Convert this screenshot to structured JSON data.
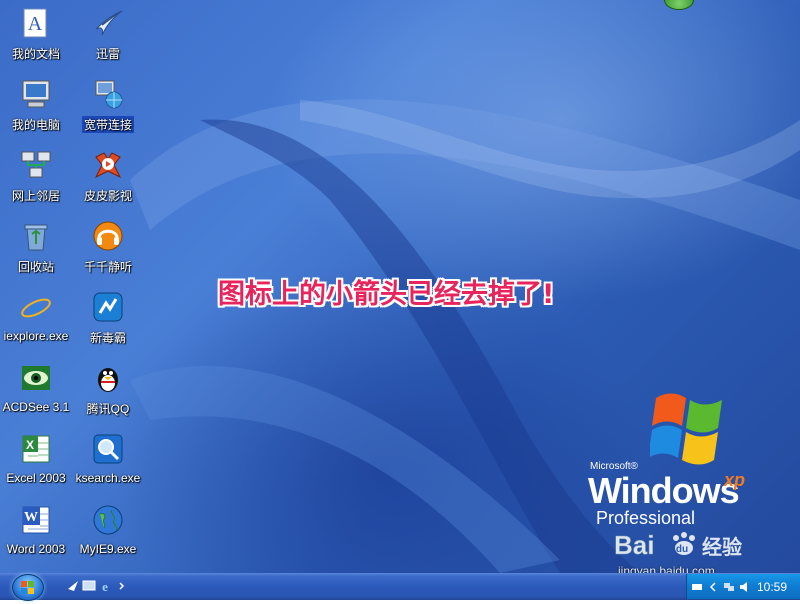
{
  "desktop": {
    "caption": "图标上的小箭头已经去掉了!",
    "icons": [
      {
        "label": "我的文档",
        "icon": "my-documents-icon"
      },
      {
        "label": "迅雷",
        "icon": "thunder-download-icon"
      },
      {
        "label": "我的电脑",
        "icon": "my-computer-icon"
      },
      {
        "label": "宽带连接",
        "icon": "broadband-connection-icon"
      },
      {
        "label": "网上邻居",
        "icon": "network-places-icon"
      },
      {
        "label": "皮皮影视",
        "icon": "pipi-video-icon"
      },
      {
        "label": "回收站",
        "icon": "recycle-bin-icon"
      },
      {
        "label": "千千静听",
        "icon": "ttplayer-icon"
      },
      {
        "label": "iexplore.exe",
        "icon": "internet-explorer-icon"
      },
      {
        "label": "新毒霸",
        "icon": "duba-antivirus-icon"
      },
      {
        "label": "ACDSee 3.1",
        "icon": "acdsee-icon"
      },
      {
        "label": "腾讯QQ",
        "icon": "qq-penguin-icon"
      },
      {
        "label": "Excel 2003",
        "icon": "excel-icon"
      },
      {
        "label": "ksearch.exe",
        "icon": "ksearch-magnifier-icon"
      },
      {
        "label": "Word 2003",
        "icon": "word-icon"
      },
      {
        "label": "MyIE9.exe",
        "icon": "myie9-globe-icon"
      }
    ]
  },
  "wallpaper": {
    "brand": "Microsoft®",
    "name": "Windows",
    "xp": "xp",
    "edition": "Professional"
  },
  "watermark": {
    "logo": "Bai du 经验",
    "url": "jingyan.baidu.com"
  },
  "taskbar": {
    "clock": "10:59"
  },
  "colors": {
    "caption": "#e8245c",
    "taskbar": "#2c5abb",
    "tray": "#0f7bd1"
  }
}
